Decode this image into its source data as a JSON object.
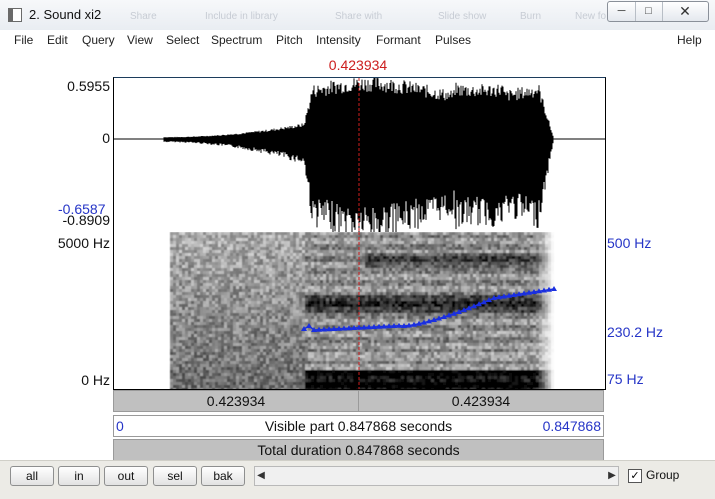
{
  "window": {
    "title": "2. Sound xi2",
    "ghost_texts": [
      "Share",
      "Include in library",
      "Share with",
      "Slide show",
      "Burn",
      "New fo"
    ]
  },
  "menu": [
    "File",
    "Edit",
    "Query",
    "View",
    "Select",
    "Spectrum",
    "Pitch",
    "Intensity",
    "Formant",
    "Pulses"
  ],
  "help": "Help",
  "icons": {
    "app": "praat-window-icon",
    "min": "minimize-icon",
    "max": "maximize-icon",
    "close": "close-icon"
  },
  "editor": {
    "cursor_time": "0.423934",
    "wave": {
      "ymax": "0.5955",
      "zero": "0",
      "ymin_sel": "-0.6587",
      "ymin": "-0.8909"
    },
    "spectrogram": {
      "top": "5000 Hz",
      "bottom": "0 Hz"
    },
    "pitch": {
      "top": "500 Hz",
      "value": "230.2 Hz",
      "bottom": "75 Hz"
    },
    "cursor_fraction": 0.5,
    "segments": [
      "0.423934",
      "0.423934"
    ],
    "visible_start": "0",
    "visible_label": "Visible part 0.847868 seconds",
    "visible_end": "0.847868",
    "total_label": "Total duration 0.847868 seconds"
  },
  "toolbar": {
    "buttons": [
      "all",
      "in",
      "out",
      "sel",
      "bak"
    ],
    "group_label": "Group",
    "group_checked": "✓"
  },
  "colors": {
    "cursor": "#cc1d1d",
    "pitch": "#1a2fe0",
    "blue_text": "#2635c7"
  }
}
